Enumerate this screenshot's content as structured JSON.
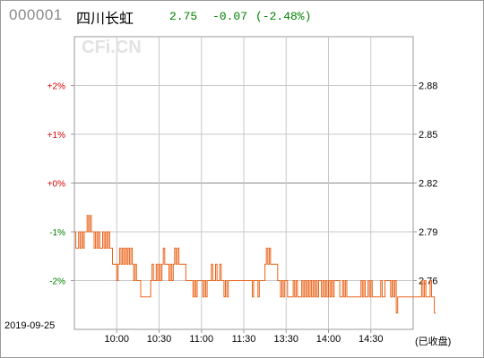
{
  "header": {
    "code": "000001",
    "name": "四川长虹",
    "price": "2.75",
    "change": "-0.07",
    "change_pct": "(-2.48%)"
  },
  "watermark": "CFi.CN",
  "date_label": "2019-09-25",
  "closed_label": "(已收盘)",
  "colors": {
    "line": "#e8641c",
    "positive": "#d40000",
    "negative": "#008000",
    "grid": "#c8c8c8",
    "frame": "#9a9a9a"
  },
  "chart_data": {
    "type": "line",
    "title": "000001 四川长虹",
    "x_range": [
      "09:30",
      "15:00"
    ],
    "x_tick_labels": [
      "10:00",
      "10:30",
      "11:00",
      "11:30",
      "13:30",
      "14:00",
      "14:30"
    ],
    "left_tick_labels": [
      "+2%",
      "+1%",
      "+0%",
      "-1%",
      "-2%"
    ],
    "right_tick_labels": [
      "2.88",
      "2.85",
      "2.82",
      "2.79",
      "2.76"
    ],
    "right_tick_values": [
      2.88,
      2.85,
      2.82,
      2.79,
      2.76
    ],
    "prev_close": 2.82,
    "ylim": [
      2.73,
      2.91
    ],
    "grid": true,
    "series": [
      {
        "minutes_per_point": 1,
        "values": [
          2.79,
          2.78,
          2.78,
          2.79,
          2.78,
          2.79,
          2.78,
          2.79,
          2.79,
          2.8,
          2.79,
          2.8,
          2.79,
          2.79,
          2.78,
          2.79,
          2.78,
          2.79,
          2.78,
          2.78,
          2.79,
          2.78,
          2.79,
          2.78,
          2.79,
          2.78,
          2.78,
          2.77,
          2.77,
          2.77,
          2.76,
          2.77,
          2.78,
          2.77,
          2.78,
          2.77,
          2.78,
          2.77,
          2.78,
          2.77,
          2.78,
          2.77,
          2.76,
          2.77,
          2.76,
          2.76,
          2.76,
          2.75,
          2.75,
          2.75,
          2.75,
          2.75,
          2.75,
          2.75,
          2.76,
          2.77,
          2.76,
          2.76,
          2.77,
          2.76,
          2.77,
          2.76,
          2.77,
          2.78,
          2.77,
          2.77,
          2.77,
          2.76,
          2.77,
          2.76,
          2.77,
          2.78,
          2.77,
          2.78,
          2.77,
          2.77,
          2.77,
          2.77,
          2.77,
          2.76,
          2.76,
          2.76,
          2.76,
          2.76,
          2.75,
          2.76,
          2.75,
          2.76,
          2.76,
          2.76,
          2.76,
          2.75,
          2.76,
          2.75,
          2.76,
          2.76,
          2.76,
          2.77,
          2.76,
          2.76,
          2.77,
          2.76,
          2.76,
          2.77,
          2.76,
          2.76,
          2.75,
          2.76,
          2.75,
          2.76,
          2.76,
          2.76,
          2.76,
          2.76,
          2.76,
          2.76,
          2.76,
          2.76,
          2.76,
          2.76,
          2.76,
          2.76,
          2.76,
          2.76,
          2.76,
          2.76,
          2.75,
          2.76,
          2.76,
          2.76,
          2.75,
          2.76,
          2.76,
          2.76,
          2.76,
          2.77,
          2.78,
          2.77,
          2.78,
          2.77,
          2.77,
          2.77,
          2.77,
          2.77,
          2.76,
          2.76,
          2.75,
          2.76,
          2.75,
          2.76,
          2.76,
          2.75,
          2.75,
          2.75,
          2.75,
          2.76,
          2.75,
          2.76,
          2.75,
          2.75,
          2.75,
          2.76,
          2.75,
          2.76,
          2.75,
          2.76,
          2.75,
          2.76,
          2.75,
          2.76,
          2.75,
          2.76,
          2.75,
          2.76,
          2.76,
          2.75,
          2.76,
          2.75,
          2.76,
          2.75,
          2.76,
          2.75,
          2.76,
          2.75,
          2.76,
          2.76,
          2.76,
          2.76,
          2.75,
          2.75,
          2.76,
          2.75,
          2.76,
          2.75,
          2.75,
          2.75,
          2.75,
          2.75,
          2.75,
          2.75,
          2.75,
          2.75,
          2.75,
          2.76,
          2.75,
          2.76,
          2.75,
          2.75,
          2.76,
          2.75,
          2.76,
          2.75,
          2.75,
          2.75,
          2.75,
          2.75,
          2.75,
          2.76,
          2.75,
          2.75,
          2.76,
          2.76,
          2.76,
          2.76,
          2.75,
          2.76,
          2.75,
          2.76,
          2.74,
          2.75,
          2.75,
          2.75,
          2.75,
          2.75,
          2.75,
          2.75,
          2.75,
          2.75,
          2.75,
          2.75,
          2.75,
          2.75,
          2.75,
          2.75,
          2.75,
          2.75,
          2.76,
          2.75,
          2.76,
          2.75,
          2.75,
          2.75,
          2.76,
          2.75,
          2.75,
          2.74,
          2.74
        ]
      }
    ]
  }
}
